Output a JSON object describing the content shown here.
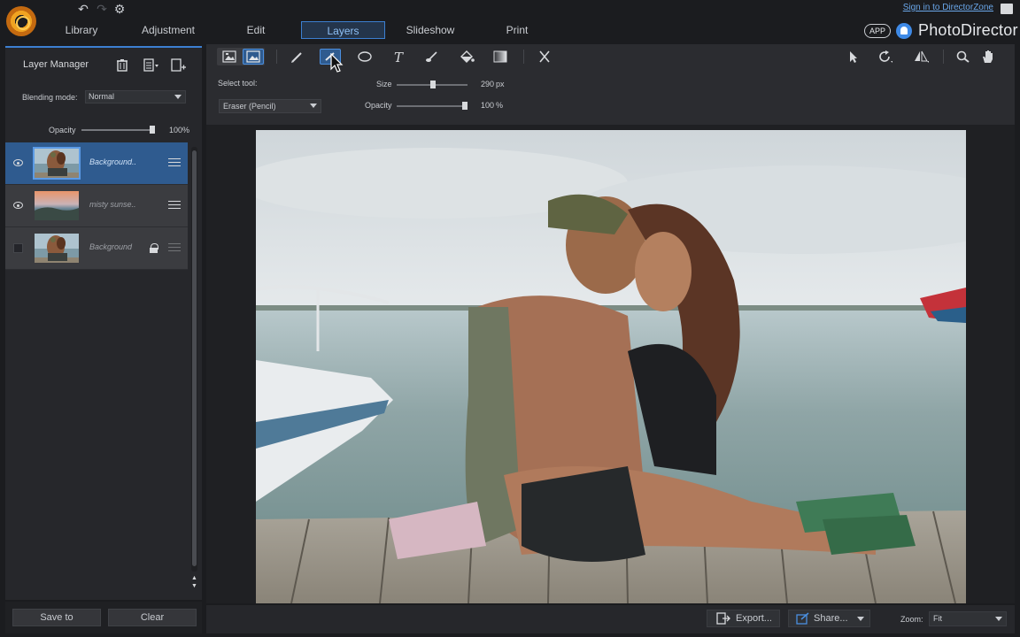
{
  "app": {
    "brand": "PhotoDirector",
    "app_badge": "APP",
    "sign_in": "Sign in to DirectorZone"
  },
  "main_tabs": [
    {
      "label": "Library"
    },
    {
      "label": "Adjustment"
    },
    {
      "label": "Edit"
    },
    {
      "label": "Layers"
    },
    {
      "label": "Slideshow"
    },
    {
      "label": "Print"
    }
  ],
  "active_tab": "Layers",
  "layer_manager": {
    "title": "Layer Manager",
    "blending_label": "Blending mode:",
    "blending_value": "Normal",
    "opacity_label": "Opacity",
    "opacity_value": "100%",
    "layers": [
      {
        "name": "Background..",
        "visible": true,
        "selected": true,
        "locked": false
      },
      {
        "name": "misty sunse..",
        "visible": true,
        "selected": false,
        "locked": false
      },
      {
        "name": "Background",
        "visible": false,
        "selected": false,
        "locked": true
      }
    ],
    "save_to": "Save to",
    "clear": "Clear"
  },
  "tool_options": {
    "select_tool_label": "Select tool:",
    "selected_tool": "Eraser (Pencil)",
    "size_label": "Size",
    "size_value": "290",
    "size_unit": "px",
    "size_fraction": 0.52,
    "opacity_label": "Opacity",
    "opacity_value": "100",
    "opacity_unit": "%",
    "opacity_fraction": 1.0
  },
  "bottom_bar": {
    "export": "Export...",
    "share": "Share...",
    "zoom_label": "Zoom:",
    "zoom_value": "Fit"
  },
  "colors": {
    "accent": "#3c7fd1",
    "selected_layer": "#2f5b8f",
    "brand_orange": "#f0a321"
  }
}
